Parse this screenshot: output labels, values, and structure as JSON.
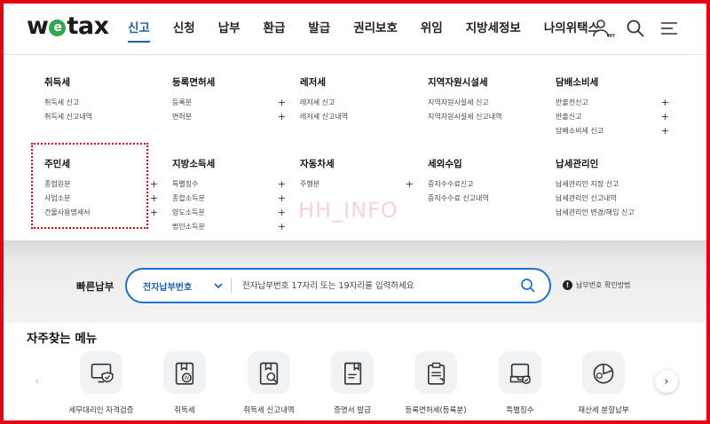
{
  "logo": {
    "w": "w",
    "e": "e",
    "rest": "tax"
  },
  "nav": [
    "신고",
    "신청",
    "납부",
    "환급",
    "발급",
    "권리보호",
    "위임",
    "지방세정보",
    "나의위택스"
  ],
  "header_icons": {
    "user_badge": "MY"
  },
  "mega_menu": [
    {
      "title": "취득세",
      "items": [
        {
          "label": "취득세 신고",
          "plus": false
        },
        {
          "label": "취득세 신고내역",
          "plus": false
        }
      ]
    },
    {
      "title": "등록면허세",
      "items": [
        {
          "label": "등록분",
          "plus": true
        },
        {
          "label": "면허분",
          "plus": true
        }
      ]
    },
    {
      "title": "레저세",
      "items": [
        {
          "label": "레저세 신고",
          "plus": false
        },
        {
          "label": "레저세 신고내역",
          "plus": false
        }
      ]
    },
    {
      "title": "지역자원시설세",
      "items": [
        {
          "label": "지역자원시설세 신고",
          "plus": false
        },
        {
          "label": "지역자원시설세 신고내역",
          "plus": false
        }
      ]
    },
    {
      "title": "담배소비세",
      "items": [
        {
          "label": "반출전신고",
          "plus": true
        },
        {
          "label": "반출신고",
          "plus": true
        },
        {
          "label": "담배소비세 신고",
          "plus": true
        }
      ]
    },
    {
      "title": "주민세",
      "items": [
        {
          "label": "종업원분",
          "plus": true
        },
        {
          "label": "사업소분",
          "plus": true
        },
        {
          "label": "건물사용명세서",
          "plus": true
        }
      ]
    },
    {
      "title": "지방소득세",
      "items": [
        {
          "label": "특별징수",
          "plus": true
        },
        {
          "label": "종합소득분",
          "plus": true
        },
        {
          "label": "양도소득분",
          "plus": true
        },
        {
          "label": "법인소득분",
          "plus": true
        }
      ]
    },
    {
      "title": "자동차세",
      "items": [
        {
          "label": "주행분",
          "plus": true
        }
      ]
    },
    {
      "title": "세외수입",
      "items": [
        {
          "label": "증지수수료신고",
          "plus": false
        },
        {
          "label": "증지수수료 신고내역",
          "plus": false
        }
      ]
    },
    {
      "title": "납세관리인",
      "items": [
        {
          "label": "납세관리인 지정 신고",
          "plus": false
        },
        {
          "label": "납세관리인 신고내역",
          "plus": false
        },
        {
          "label": "납세관리인 변경/해임 신고",
          "plus": false
        }
      ]
    }
  ],
  "watermark": "HH_INFO",
  "quick_pay": {
    "label": "빠른납부",
    "select_value": "전자납부번호",
    "placeholder": "전자납부번호 17자리 또는 19자리를 입력하세요",
    "help": "납부번호 확인방법"
  },
  "favorites": {
    "title": "자주찾는 메뉴",
    "items": [
      {
        "label": "세무대리인 자격검증",
        "icon": "monitor-shield-icon"
      },
      {
        "label": "취득세",
        "icon": "document-coin-icon"
      },
      {
        "label": "취득세 신고내역",
        "icon": "document-search-icon"
      },
      {
        "label": "증명서 발급",
        "icon": "certificate-icon"
      },
      {
        "label": "등록면허세(등록분)",
        "icon": "clipboard-icon"
      },
      {
        "label": "특별징수",
        "icon": "inbox-check-icon"
      },
      {
        "label": "재산세 분할납부",
        "icon": "pie-chart-icon"
      }
    ]
  },
  "colors": {
    "accent": "#1d5fb8",
    "frame": "#e60012",
    "input_border": "#1d6fd0"
  }
}
